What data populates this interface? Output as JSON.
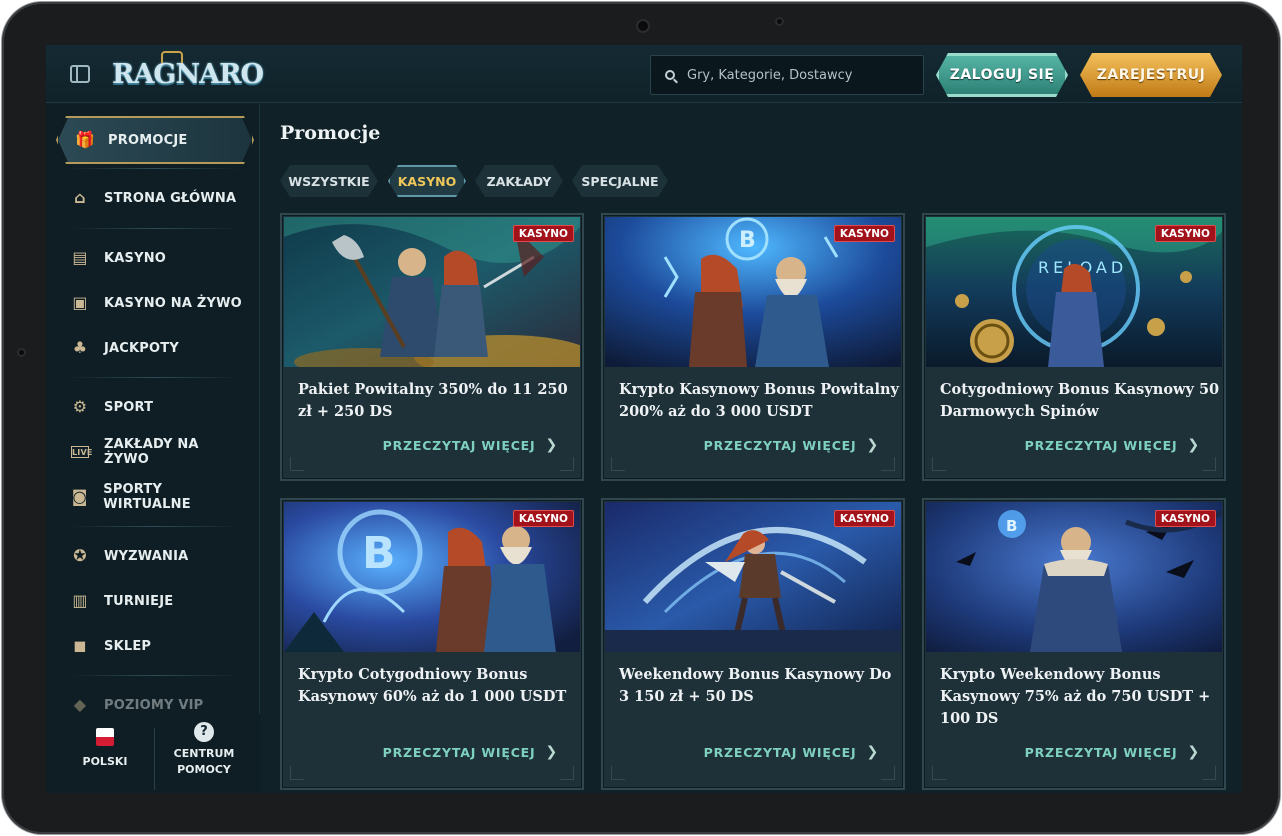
{
  "header": {
    "logo_text": "RAGNARO",
    "search_placeholder": "Gry, Kategorie, Dostawcy",
    "login_label": "ZALOGUJ SIĘ",
    "register_label": "ZAREJESTRUJ"
  },
  "sidebar": {
    "items": [
      {
        "label": "PROMOCJE",
        "icon": "gift-icon"
      },
      {
        "label": "STRONA GŁÓWNA",
        "icon": "home-icon"
      },
      {
        "label": "KASYNO",
        "icon": "slot-machine-icon"
      },
      {
        "label": "KASYNO NA ŻYWO",
        "icon": "live-card-icon"
      },
      {
        "label": "JACKPOTY",
        "icon": "clover-icon"
      },
      {
        "label": "SPORT",
        "icon": "ball-icon"
      },
      {
        "label": "ZAKŁADY NA ŻYWO",
        "icon": "live-badge-icon"
      },
      {
        "label": "SPORTY WIRTUALNE",
        "icon": "virtual-icon"
      },
      {
        "label": "WYZWANIA",
        "icon": "medal-icon"
      },
      {
        "label": "TURNIEJE",
        "icon": "podium-icon"
      },
      {
        "label": "SKLEP",
        "icon": "shop-bag-icon"
      },
      {
        "label": "POZIOMY VIP",
        "icon": "diamond-icon"
      }
    ],
    "language": "POLSKI",
    "help_line1": "CENTRUM",
    "help_line2": "POMOCY"
  },
  "main": {
    "title": "Promocje",
    "filters": [
      {
        "label": "WSZYSTKIE",
        "active": false
      },
      {
        "label": "KASYNO",
        "active": true
      },
      {
        "label": "ZAKŁADY",
        "active": false
      },
      {
        "label": "SPECJALNE",
        "active": false
      }
    ],
    "read_more": "PRZECZYTAJ WIĘCEJ",
    "cards": [
      {
        "badge": "KASYNO",
        "title": "Pakiet Powitalny 350% do 11 250 zł + 250 DS"
      },
      {
        "badge": "KASYNO",
        "title": "Krypto Kasynowy Bonus Powitalny 200% aż do 3 000 USDT"
      },
      {
        "badge": "KASYNO",
        "title": "Cotygodniowy Bonus Kasynowy 50 Darmowych Spinów"
      },
      {
        "badge": "KASYNO",
        "title": "Krypto Cotygodniowy Bonus Kasynowy 60% aż do 1 000 USDT"
      },
      {
        "badge": "KASYNO",
        "title": "Weekendowy Bonus Kasynowy Do 3 150 zł + 50 DS"
      },
      {
        "badge": "KASYNO",
        "title": "Krypto Weekendowy Bonus Kasynowy 75% aż do 750 USDT + 100 DS"
      }
    ]
  },
  "colors": {
    "accent_teal": "#7fd1bf",
    "accent_gold": "#f0c85a",
    "badge_red": "#a1121a",
    "background": "#112128"
  }
}
